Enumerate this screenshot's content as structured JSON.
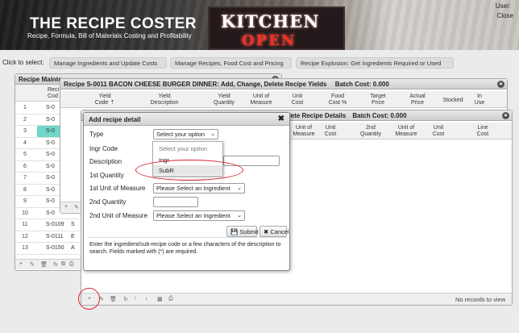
{
  "header": {
    "title": "THE RECIPE COSTER",
    "subtitle": "Recipe, Formula, Bill of Materials Costing and Profitability",
    "sign_top": "KITCHEN",
    "sign_bottom": "OPEN",
    "user_label": "User:",
    "close_label": "Close"
  },
  "select_bar": {
    "label": "Click to select:",
    "buttons": [
      "Manage Ingredients and Update Costs",
      "Manage Recipes, Food Cost and Pricing",
      "Recipe Explosion: Get Ingredients Required or Used"
    ]
  },
  "recipe_maint": {
    "title": "Recipe Mainte",
    "code_hdr_1": "Reci",
    "code_hdr_2": "Cod",
    "rows": [
      {
        "num": "1",
        "code": "S-0"
      },
      {
        "num": "2",
        "code": "S-0"
      },
      {
        "num": "3",
        "code": "S-0"
      },
      {
        "num": "4",
        "code": "S-0"
      },
      {
        "num": "5",
        "code": "S-0"
      },
      {
        "num": "6",
        "code": "S-0"
      },
      {
        "num": "7",
        "code": "S-0"
      },
      {
        "num": "8",
        "code": "S-0"
      },
      {
        "num": "9",
        "code": "S-0"
      },
      {
        "num": "10",
        "code": "S-0"
      },
      {
        "num": "11",
        "code": "S-0109"
      },
      {
        "num": "12",
        "code": "S-0111"
      },
      {
        "num": "13",
        "code": "S-0150"
      }
    ],
    "row_suffix": [
      "",
      "",
      "",
      "",
      "",
      "",
      "",
      "",
      "",
      "",
      "S",
      "E",
      "A"
    ]
  },
  "yields_panel": {
    "title": "Recipe S-0011 BACON CHEESE BURGER DINNER: Add, Change, Delete Recipe Yields",
    "batch_cost": "Batch Cost: 0.000",
    "columns": [
      {
        "l1": "Yield",
        "l2": "Code ⇡"
      },
      {
        "l1": "Yield",
        "l2": "Description"
      },
      {
        "l1": "Yield",
        "l2": "Quantity"
      },
      {
        "l1": "Unit of",
        "l2": "Measure"
      },
      {
        "l1": "Unit",
        "l2": "Cost"
      },
      {
        "l1": "Food",
        "l2": "Cost %"
      },
      {
        "l1": "Target",
        "l2": "Price"
      },
      {
        "l1": "Actual",
        "l2": "Price"
      },
      {
        "l1": "Stocked",
        "l2": ""
      },
      {
        "l1": "In",
        "l2": "Use"
      }
    ]
  },
  "details_panel": {
    "title": "elete Recipe Details",
    "batch_cost": "Batch Cost: 0.000",
    "columns": [
      {
        "l1": "Unit of",
        "l2": "Measure"
      },
      {
        "l1": "Unit",
        "l2": "Cost"
      },
      {
        "l1": "2nd",
        "l2": "Quantity"
      },
      {
        "l1": "Unit of",
        "l2": "Measure"
      },
      {
        "l1": "Unit",
        "l2": "Cost"
      },
      {
        "l1": "Line",
        "l2": "Cost"
      }
    ],
    "status": "No records to view"
  },
  "modal": {
    "title": "Add recipe detail",
    "close": "✖",
    "labels": {
      "type": "Type",
      "ingr_code": "Ingr Code",
      "description": "Description",
      "qty1": "1st Quantity",
      "uom1": "1st Unit of Measure",
      "qty2": "2nd Quantity",
      "uom2": "2nd Unit of Measure"
    },
    "type_value": "Select your option",
    "uom1_value": "Please Select an Ingredient",
    "uom2_value": "Please Select an Ingredient",
    "submit": "💾 Submit",
    "cancel": "✖ Cancel",
    "help": "Enter the ingredient/sub-recipe code or a few characters of the description to search. Fields marked with (*) are required."
  },
  "dropdown": {
    "options": [
      "Select your option",
      "Ingr",
      "SubR"
    ]
  },
  "colors": {
    "highlight": "#6fd6c9",
    "annotation": "#d8232a"
  }
}
